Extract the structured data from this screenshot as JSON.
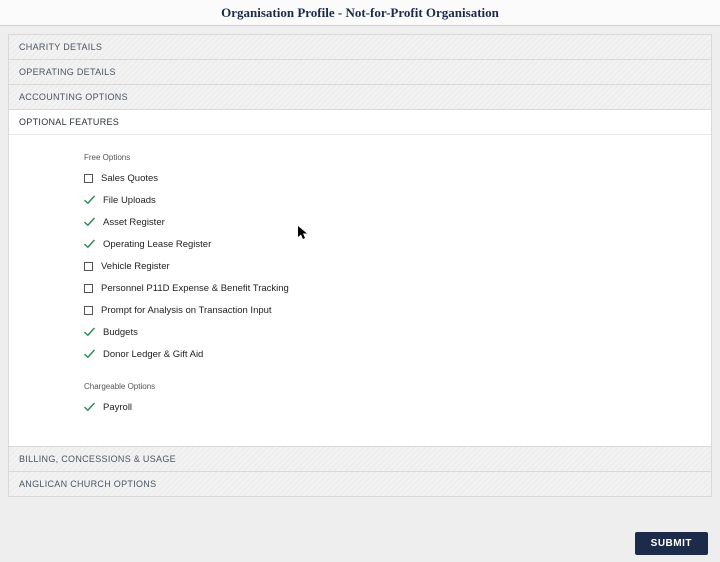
{
  "page_title": "Organisation Profile - Not-for-Profit Organisation",
  "sections": [
    {
      "label": "CHARITY DETAILS"
    },
    {
      "label": "OPERATING DETAILS"
    },
    {
      "label": "ACCOUNTING OPTIONS"
    },
    {
      "label": "OPTIONAL FEATURES"
    },
    {
      "label": "BILLING, CONCESSIONS & USAGE"
    },
    {
      "label": "ANGLICAN CHURCH OPTIONS"
    }
  ],
  "active_section_index": 3,
  "optional_features": {
    "free_group_label": "Free Options",
    "free_items": [
      {
        "label": "Sales Quotes",
        "checked": false
      },
      {
        "label": "File Uploads",
        "checked": true
      },
      {
        "label": "Asset Register",
        "checked": true
      },
      {
        "label": "Operating Lease Register",
        "checked": true
      },
      {
        "label": "Vehicle Register",
        "checked": false
      },
      {
        "label": "Personnel P11D Expense & Benefit Tracking",
        "checked": false
      },
      {
        "label": "Prompt for Analysis on Transaction Input",
        "checked": false
      },
      {
        "label": "Budgets",
        "checked": true
      },
      {
        "label": "Donor Ledger & Gift Aid",
        "checked": true
      }
    ],
    "chargeable_group_label": "Chargeable Options",
    "chargeable_items": [
      {
        "label": "Payroll",
        "checked": true
      }
    ]
  },
  "submit_label": "SUBMIT",
  "colors": {
    "accent": "#1c2b4a",
    "tick": "#2d8a5a"
  }
}
